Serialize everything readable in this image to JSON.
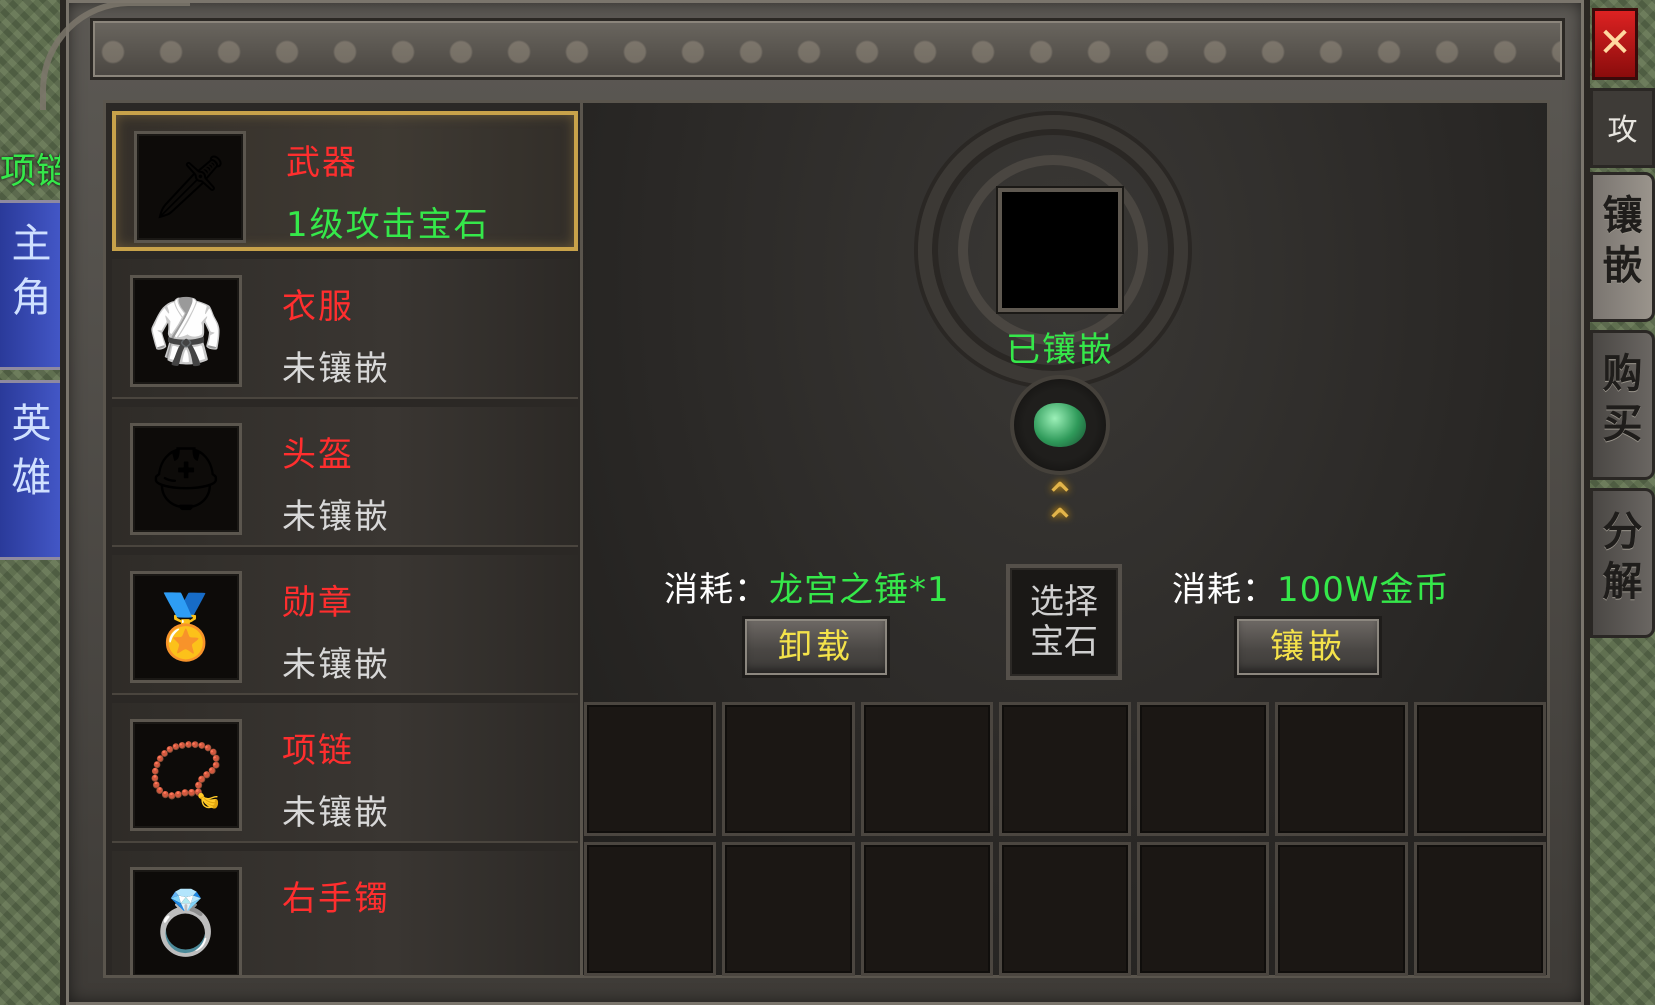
{
  "left_tabs": {
    "edge_label": "项链",
    "main": "主角",
    "hero": "英雄"
  },
  "right_tabs": {
    "guide": "攻略",
    "embed": "镶嵌",
    "buy": "购买",
    "decompose": "分解"
  },
  "slots": [
    {
      "name": "武器",
      "status": "1级攻击宝石",
      "icon": "sword-icon",
      "glyph": "🗡",
      "selected": true
    },
    {
      "name": "衣服",
      "status": "未镶嵌",
      "icon": "armor-icon",
      "glyph": "🥋"
    },
    {
      "name": "头盔",
      "status": "未镶嵌",
      "icon": "helmet-icon",
      "glyph": "⛑"
    },
    {
      "name": "勋章",
      "status": "未镶嵌",
      "icon": "medal-icon",
      "glyph": "🏅"
    },
    {
      "name": "项链",
      "status": "未镶嵌",
      "icon": "necklace-icon",
      "glyph": "📿"
    },
    {
      "name": "右手镯",
      "status": "",
      "icon": "bracelet-icon",
      "glyph": "💍"
    }
  ],
  "work": {
    "target_icon": "sword-icon",
    "target_glyph": "🗡",
    "embed_status": "已镶嵌",
    "gem_icon": "green-gem-icon",
    "cost_left_label": "消耗：",
    "cost_left_value": "龙宫之锤*1",
    "cost_right_label": "消耗：",
    "cost_right_value": "100W金币",
    "unload_label": "卸载",
    "embed_label": "镶嵌",
    "select_gem_line1": "选择",
    "select_gem_line2": "宝石"
  },
  "close_label": "✕",
  "colors": {
    "slot_name": "#ff2e2e",
    "status_green": "#35e84a",
    "button_text": "#f4e24a",
    "selected_border": "#c8a24a"
  }
}
